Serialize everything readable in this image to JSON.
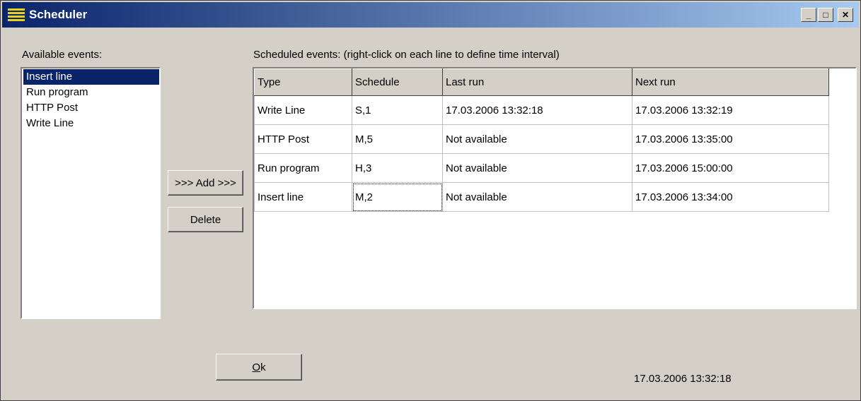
{
  "window": {
    "title": "Scheduler",
    "minimize": "_",
    "maximize": "□",
    "close": "✕"
  },
  "available": {
    "label": "Available events:",
    "items": [
      "Insert line",
      "Run program",
      "HTTP Post",
      "Write Line"
    ],
    "selected_index": 0
  },
  "scheduled": {
    "label": "Scheduled events: (right-click on each line to define time interval)",
    "columns": [
      "Type",
      "Schedule",
      "Last run",
      "Next run"
    ],
    "rows": [
      [
        "Write Line",
        "S,1",
        "17.03.2006 13:32:18",
        "17.03.2006 13:32:19"
      ],
      [
        "HTTP Post",
        "M,5",
        "Not available",
        "17.03.2006 13:35:00"
      ],
      [
        "Run program",
        "H,3",
        "Not available",
        "17.03.2006 15:00:00"
      ],
      [
        "Insert line",
        "M,2",
        "Not available",
        "17.03.2006 13:34:00"
      ]
    ]
  },
  "buttons": {
    "add": ">>> Add >>>",
    "delete": "Delete",
    "ok": "Ok"
  },
  "status": {
    "clock": "17.03.2006 13:32:18"
  },
  "colors": {
    "selection": "#0a246a",
    "face": "#d4d0c8"
  }
}
